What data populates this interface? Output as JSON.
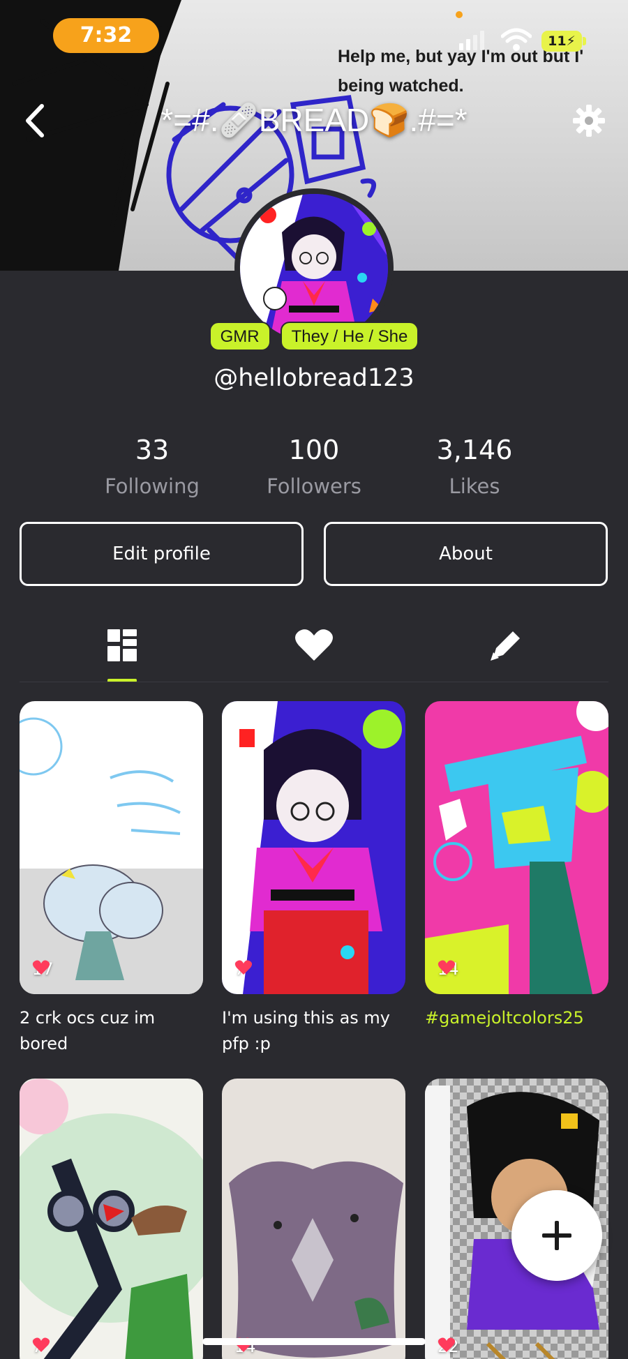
{
  "status_bar": {
    "time": "7:32",
    "battery": "11"
  },
  "banner": {
    "caption": "Help me, but yay I'm out but I'\nbeing watched."
  },
  "header": {
    "title": "*=#.🩹BREAD🍞.#=*"
  },
  "profile": {
    "tags": [
      "GMR",
      "They / He / She"
    ],
    "username": "@hellobread123",
    "stats": [
      {
        "value": "33",
        "label": "Following"
      },
      {
        "value": "100",
        "label": "Followers"
      },
      {
        "value": "3,146",
        "label": "Likes"
      }
    ],
    "edit_label": "Edit profile",
    "about_label": "About"
  },
  "tabs": {
    "active": "posts",
    "items": [
      "posts-grid-icon",
      "heart-icon",
      "pencil-icon"
    ]
  },
  "posts": [
    {
      "likes": "17",
      "caption": "2 crk ocs cuz im bored"
    },
    {
      "likes": "7",
      "caption": "I'm using this as my pfp :p"
    },
    {
      "likes": "14",
      "caption": "#gamejoltcolors25"
    },
    {
      "likes": "7",
      "caption": ""
    },
    {
      "likes": "14",
      "caption": ""
    },
    {
      "likes": "22",
      "caption": ""
    }
  ],
  "colors": {
    "accent": "#c9f22a",
    "background": "#2a2a2f",
    "time_pill": "#f7a21b",
    "heart": "#ff3b5c"
  }
}
